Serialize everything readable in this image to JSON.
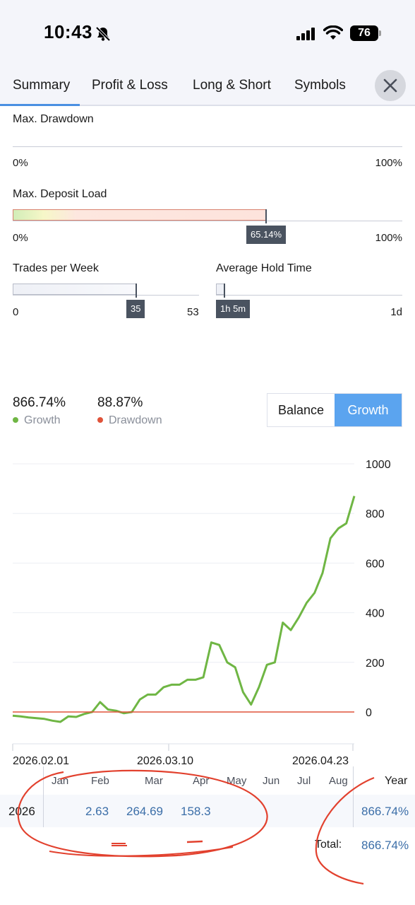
{
  "status_bar": {
    "time": "10:43",
    "battery": "76"
  },
  "tabs": [
    {
      "label": "Summary",
      "active": true
    },
    {
      "label": "Profit & Loss",
      "active": false
    },
    {
      "label": "Long & Short",
      "active": false
    },
    {
      "label": "Symbols",
      "active": false
    }
  ],
  "max_drawdown": {
    "label": "Max. Drawdown",
    "min": "0%",
    "max": "100%"
  },
  "max_deposit_load": {
    "label": "Max. Deposit Load",
    "min": "0%",
    "max": "100%",
    "value": "65.14%",
    "fraction": 0.6514
  },
  "trades_per_week": {
    "label": "Trades per Week",
    "min": "0",
    "max": "53",
    "value": "35",
    "fraction": 0.66
  },
  "avg_hold_time": {
    "label": "Average Hold Time",
    "value": "1h 5m",
    "max": "1d",
    "fraction": 0.045
  },
  "stats": {
    "growth_value": "866.74%",
    "growth_label": "Growth",
    "drawdown_value": "88.87%",
    "drawdown_label": "Drawdown"
  },
  "toggle": {
    "balance": "Balance",
    "growth": "Growth",
    "selected": "Growth"
  },
  "colors": {
    "accent": "#5ba4ef",
    "growth_line": "#6fb644",
    "drawdown_line": "#e0533a",
    "value_blue": "#3b6ea8"
  },
  "chart_data": {
    "type": "line",
    "y_ticks": [
      "1000",
      "800",
      "600",
      "400",
      "200",
      "0"
    ],
    "ylim": [
      -130,
      1000
    ],
    "x_ticks": [
      "2026.02.01",
      "2026.03.10",
      "2026.04.23"
    ],
    "series": [
      {
        "name": "Growth",
        "color": "#6fb644",
        "values": [
          -15,
          -18,
          -22,
          -25,
          -28,
          -35,
          -40,
          -18,
          -20,
          -8,
          0,
          40,
          10,
          5,
          -5,
          0,
          50,
          70,
          70,
          100,
          110,
          110,
          130,
          130,
          140,
          280,
          270,
          200,
          180,
          80,
          30,
          100,
          190,
          200,
          360,
          330,
          380,
          440,
          480,
          560,
          700,
          740,
          760,
          870
        ]
      },
      {
        "name": "Drawdown",
        "color": "#e0533a",
        "values": [
          0,
          0,
          0,
          0,
          0,
          0,
          0,
          0,
          0,
          0,
          0,
          0,
          0,
          0,
          0,
          0,
          0,
          0,
          0,
          0,
          0,
          0,
          0,
          0,
          0,
          0,
          0,
          0,
          0,
          0,
          0,
          0,
          0,
          0,
          0,
          0,
          0,
          0,
          0,
          0,
          0,
          0,
          0,
          0
        ]
      }
    ],
    "grid": true
  },
  "monthly_table": {
    "months": [
      "Jan",
      "Feb",
      "Mar",
      "Apr",
      "May",
      "Jun",
      "Jul",
      "Aug"
    ],
    "year_header": "Year",
    "year": "2026",
    "values": [
      "",
      "2.63",
      "264.69",
      "158.3",
      "",
      "",
      "",
      ""
    ],
    "year_total": "866.74%",
    "total_label": "Total:",
    "total_value": "866.74%"
  }
}
